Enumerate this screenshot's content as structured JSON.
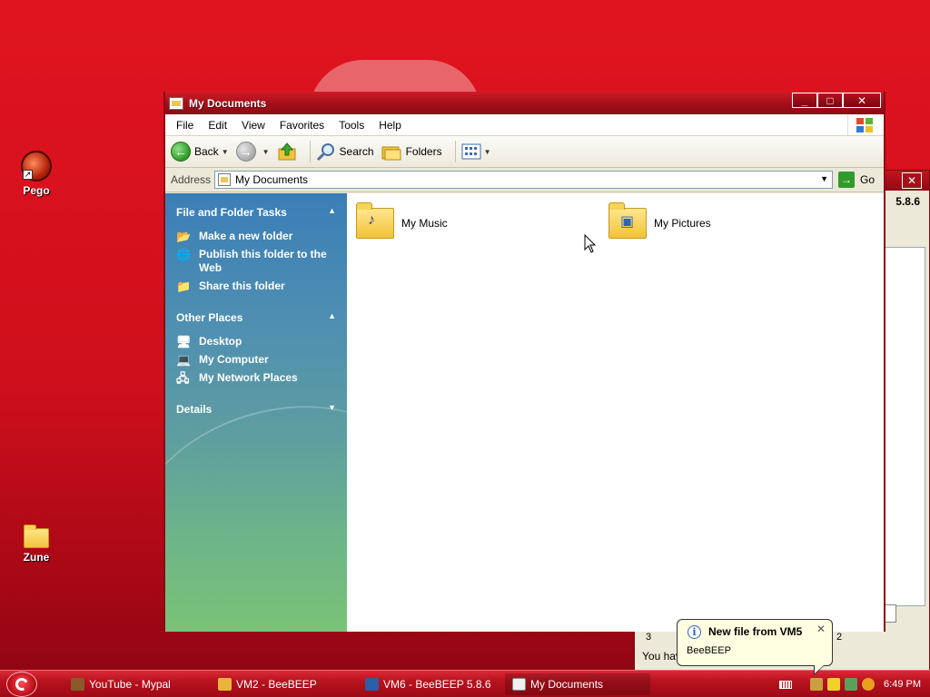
{
  "desktop": {
    "icons": [
      {
        "label": "Pego"
      },
      {
        "label": "Zune"
      }
    ]
  },
  "background_window": {
    "version_text": "5.8.6",
    "row_left": "3",
    "row_right": "2",
    "status_text": "You hav"
  },
  "window": {
    "title": "My Documents",
    "controls": {
      "minimize": "_",
      "maximize": "□",
      "close": "✕"
    },
    "menu": [
      "File",
      "Edit",
      "View",
      "Favorites",
      "Tools",
      "Help"
    ],
    "toolbar": {
      "back": "Back",
      "search": "Search",
      "folders": "Folders"
    },
    "address": {
      "label": "Address",
      "value": "My Documents",
      "go": "Go"
    },
    "taskpane": {
      "file_tasks": {
        "title": "File and Folder Tasks",
        "items": [
          "Make a new folder",
          "Publish this folder to the Web",
          "Share this folder"
        ]
      },
      "other_places": {
        "title": "Other Places",
        "items": [
          "Desktop",
          "My Computer",
          "My Network Places"
        ]
      },
      "details": {
        "title": "Details"
      }
    },
    "folders": [
      {
        "name": "My Music"
      },
      {
        "name": "My Pictures"
      }
    ]
  },
  "balloon": {
    "title": "New file from VM5",
    "text": "BeeBEEP",
    "close": "✕"
  },
  "taskbar": {
    "buttons": [
      {
        "label": "YouTube - Mypal"
      },
      {
        "label": "VM2 - BeeBEEP"
      },
      {
        "label": "VM6 - BeeBEEP 5.8.6"
      },
      {
        "label": "My Documents"
      }
    ],
    "clock": "6:49 PM"
  },
  "colors": {
    "accent": "#c41520",
    "taskpane_top": "#3a7eb6",
    "taskpane_bottom": "#7ac377"
  }
}
